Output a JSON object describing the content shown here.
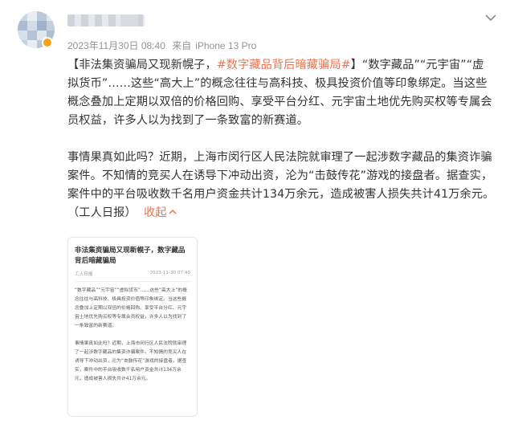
{
  "post": {
    "timestamp": "2023年11月30日 08:40",
    "source_prefix": "来自",
    "source_device": "iPhone 13 Pro",
    "p1_open": "【",
    "p1_title": "非法集资骗局又现新幌子，",
    "p1_hashtag": "#数字藏品背后暗藏骗局#",
    "p1_rest": "】“数字藏品”“元宇宙”“虚拟货币”……这些“高大上”的概念往往与高科技、极具投资价值等印象绑定。当这些概念叠加上定期以双倍的价格回购、享受平台分红、元宇宙土地优先购买权等专属会员权益，许多人以为找到了一条致富的新赛道。",
    "p2": "事情果真如此吗？近期，上海市闵行区人民法院就审理了一起涉数字藏品的集资诈骗案件。不知情的竞买人在诱导下冲动出资，沦为“击鼓传花”游戏的接盘者。据查实，案件中的平台吸收数千名用户资金共计134万余元，造成被害人损失共计41万余元。（工人日报）",
    "collapse_label": "收起",
    "collapse_arrow": "^"
  },
  "article_card": {
    "title": "非法集资骗局又现新幌子，数字藏品背后暗藏骗局",
    "source": "工人日报",
    "date": "2023-11-30 07:40",
    "para1": "“数字藏品”“元宇宙”“虚拟货币”……这些“高大上”的概念往往与高科技、极具投资价值等印象绑定。当这些概念叠加上定期以双倍的价格回购、享受平台分红、元宇宙土地优先购买权等专属会员权益，许多人以为找到了一条致富的新赛道。",
    "para2": "事情果真如此吗？近期，上海市闵行区人民法院就审理了一起涉数字藏品的集资诈骗案件。不知情的竞买人在诱导下冲动出资，沦为“击鼓传花”游戏的接盘者。据查实，案件中的平台吸收数千名用户资金共计134万余元，造成被害人损失共计41万余元。"
  },
  "icons": {
    "avatar": "blurred-avatar-icon",
    "badge": "verified-badge-icon",
    "menu": "chevron-down-icon"
  },
  "colors": {
    "accent": "#eb7350",
    "meta_text": "#939393",
    "body_text": "#333333",
    "badge": "#f7a21b"
  }
}
